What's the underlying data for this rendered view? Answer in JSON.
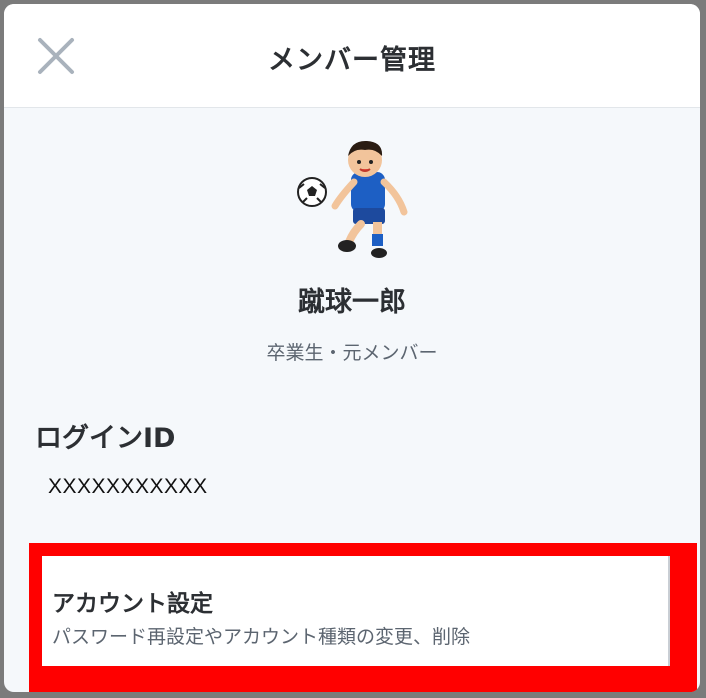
{
  "header": {
    "title": "メンバー管理",
    "close_icon": "close-icon"
  },
  "member": {
    "avatar_icon": "soccer-player-illustration",
    "name": "蹴球一郎",
    "role": "卒業生・元メンバー"
  },
  "login": {
    "label": "ログインID",
    "value": "XXXXXXXXXXX"
  },
  "account_settings": {
    "title": "アカウント設定",
    "description": "パスワード再設定やアカウント種類の変更、削除"
  },
  "colors": {
    "highlight": "#ff0000",
    "background": "#f5f8fb",
    "text": "#2c2f33",
    "subtext": "#5c6570"
  }
}
